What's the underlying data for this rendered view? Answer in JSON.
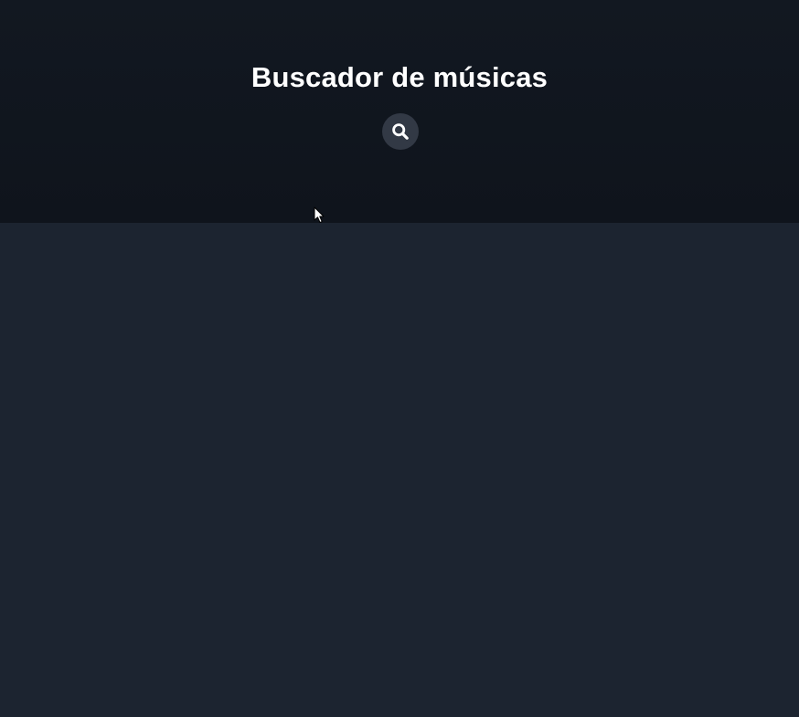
{
  "header": {
    "title": "Buscador de músicas",
    "search_button": {
      "icon": "search-icon"
    }
  },
  "colors": {
    "header_background": "#10151d",
    "main_background": "#1c2430",
    "button_background": "#323945",
    "text": "#ffffff"
  }
}
